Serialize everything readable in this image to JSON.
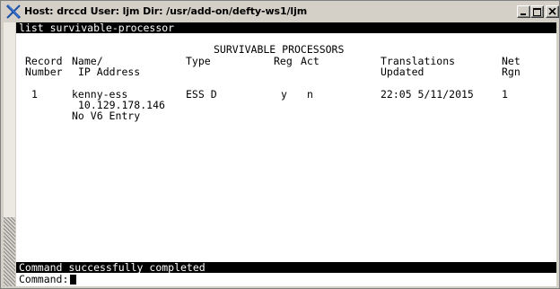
{
  "window": {
    "host_label": "Host:",
    "host_value": "drccd",
    "user_label": "User:",
    "user_value": "ljm",
    "dir_label": "Dir:",
    "dir_value": "/usr/add-on/defty-ws1/ljm"
  },
  "terminal": {
    "command": "list survivable-processor",
    "report_title": "SURVIVABLE PROCESSORS",
    "headers": {
      "record_1": "Record",
      "record_2": "Number",
      "name_1": "Name/",
      "name_2": "IP Address",
      "type": "Type",
      "reg": "Reg",
      "act": "Act",
      "trans_1": "Translations",
      "trans_2": "Updated",
      "net_1": "Net",
      "net_2": "Rgn"
    },
    "row": {
      "number": "1",
      "name": "kenny-ess",
      "ip": "10.129.178.146",
      "v6": "No V6 Entry",
      "type": "ESS D",
      "reg": "y",
      "act": "n",
      "updated": "22:05 5/11/2015",
      "net_rgn": "1"
    },
    "status": "Command successfully completed",
    "prompt": "Command:"
  }
}
